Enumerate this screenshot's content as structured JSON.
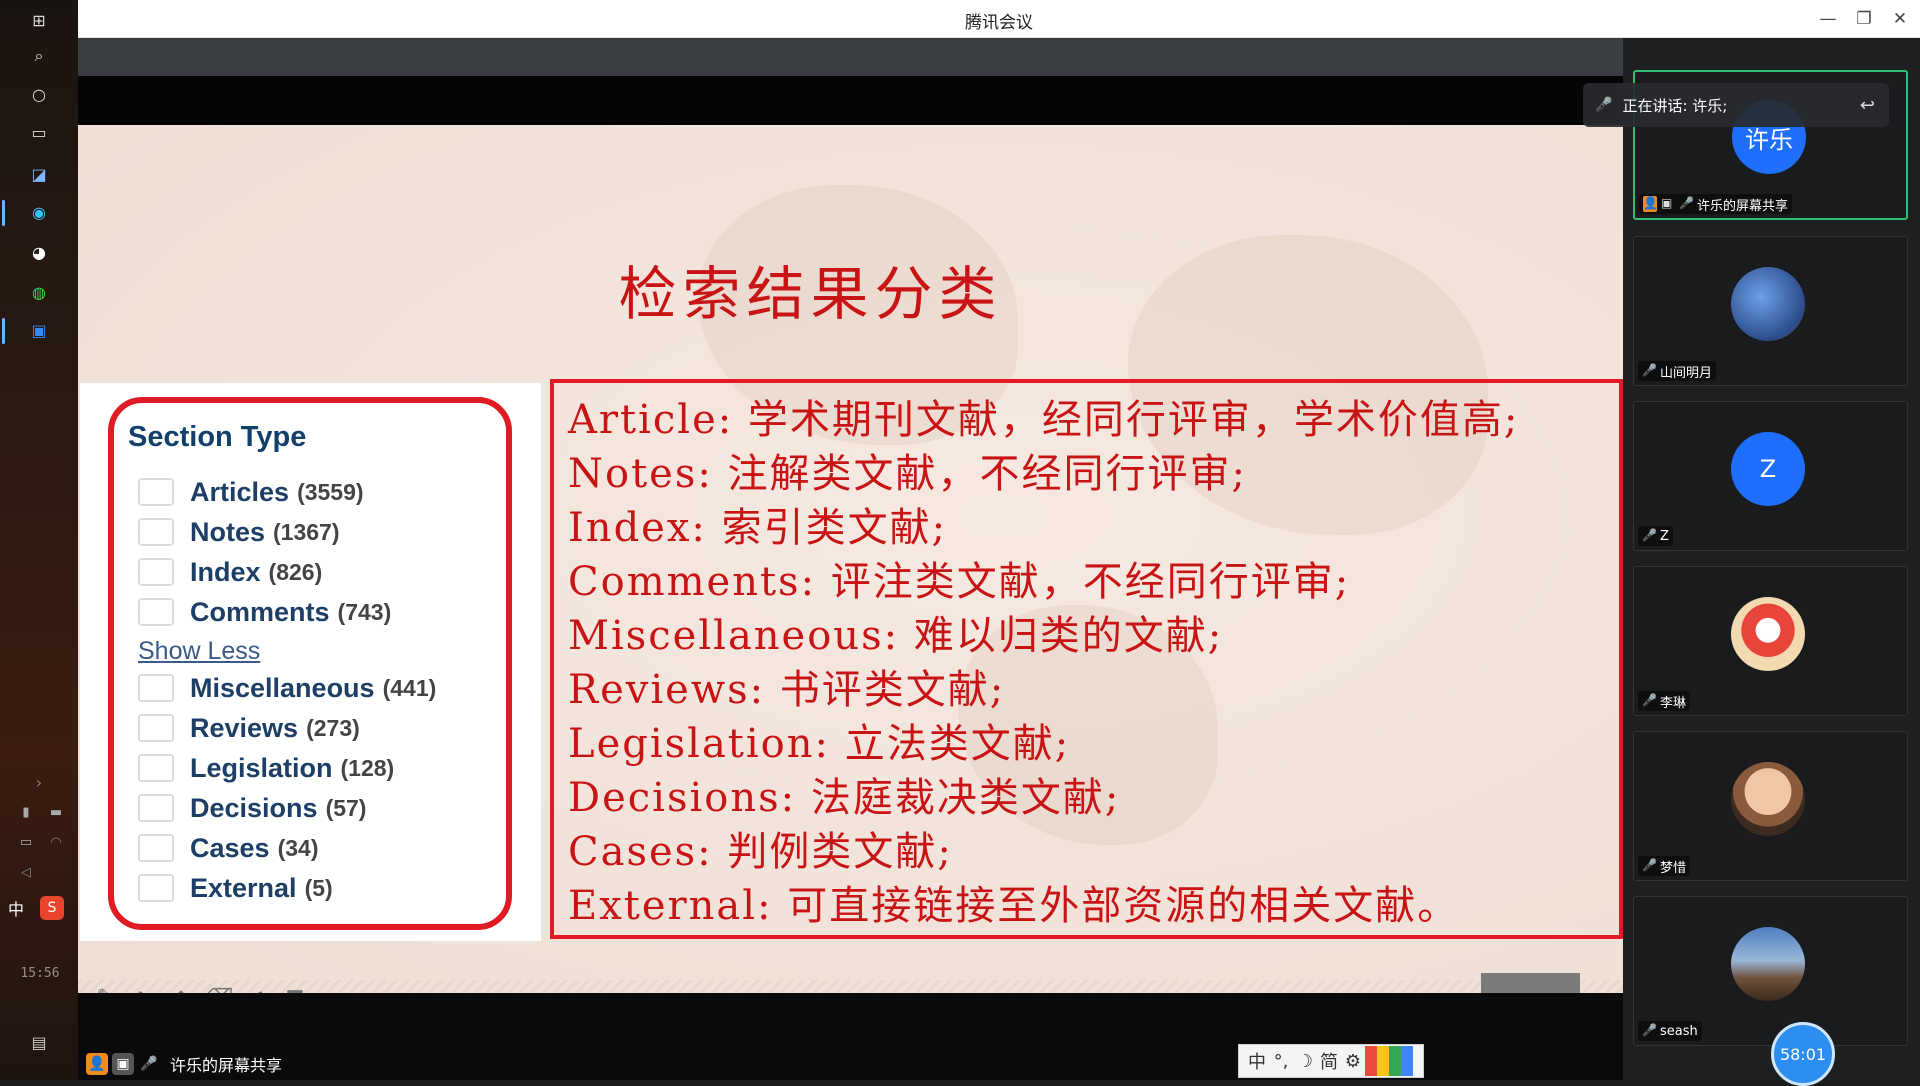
{
  "app": {
    "title": "腾讯会议"
  },
  "window_controls": {
    "minimize": "—",
    "restore": "❐",
    "close": "✕"
  },
  "taskbar": {
    "clock": "15:56",
    "ime": "中"
  },
  "slide": {
    "title": "检索结果分类",
    "section_type": {
      "heading": "Section Type",
      "items": [
        {
          "label": "Articles",
          "count": "(3559)"
        },
        {
          "label": "Notes",
          "count": "(1367)"
        },
        {
          "label": "Index",
          "count": "(826)"
        },
        {
          "label": "Comments",
          "count": "(743)"
        },
        {
          "label": "Miscellaneous",
          "count": "(441)"
        },
        {
          "label": "Reviews",
          "count": "(273)"
        },
        {
          "label": "Legislation",
          "count": "(128)"
        },
        {
          "label": "Decisions",
          "count": "(57)"
        },
        {
          "label": "Cases",
          "count": "(34)"
        },
        {
          "label": "External",
          "count": "(5)"
        }
      ],
      "show_less": "Show Less"
    },
    "definitions": [
      "Article: 学术期刊文献，经同行评审，学术价值高;",
      "Notes: 注解类文献，不经同行评审;",
      "Index: 索引类文献;",
      "Comments: 评注类文献，不经同行评审;",
      "Miscellaneous: 难以归类的文献;",
      "Reviews: 书评类文献;",
      "Legislation: 立法类文献;",
      "Decisions: 法庭裁决类文献;",
      "Cases: 判例类文献;",
      "External: 可直接链接至外部资源的相关文献。"
    ]
  },
  "share_status": {
    "text": "许乐的屏幕共享"
  },
  "ime_bar": {
    "items": [
      "中",
      "°,",
      "☽",
      "简",
      "⚙"
    ],
    "colors": [
      "#e84a3c",
      "#f5c518",
      "#34a853",
      "#4285f4"
    ]
  },
  "speaking": {
    "text": "正在讲话: 许乐;"
  },
  "participants": [
    {
      "name": "许乐的屏幕共享",
      "avatar_text": "许乐",
      "avatar_color": "#1f6fff"
    },
    {
      "name": "山间明月",
      "avatar_text": "",
      "avatar_color": "#4a6fb4"
    },
    {
      "name": "Z",
      "avatar_text": "Z",
      "avatar_color": "#1f6fff"
    },
    {
      "name": "李琳",
      "avatar_text": "",
      "avatar_color": "#f3d9b0"
    },
    {
      "name": "梦惜",
      "avatar_text": "",
      "avatar_color": "#c98b6b"
    },
    {
      "name": "seash",
      "avatar_text": "",
      "avatar_color": "#6f8fb8"
    }
  ],
  "timer": "58:01"
}
